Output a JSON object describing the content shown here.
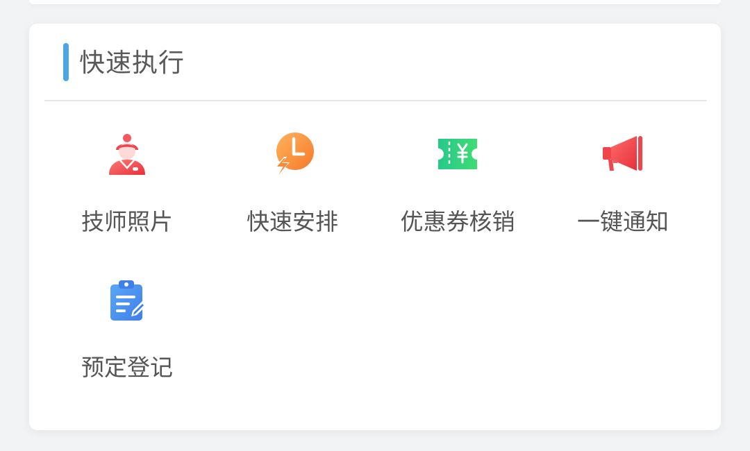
{
  "section": {
    "title": "快速执行",
    "accent_color": "#4ea5e6"
  },
  "actions": [
    {
      "label": "技师照片",
      "icon": "technician-icon",
      "color": "#f0454d"
    },
    {
      "label": "快速安排",
      "icon": "clock-lightning-icon",
      "color": "#f7903a"
    },
    {
      "label": "优惠券核销",
      "icon": "coupon-icon",
      "color": "#2fd27c"
    },
    {
      "label": "一键通知",
      "icon": "megaphone-icon",
      "color": "#f0454d"
    },
    {
      "label": "预定登记",
      "icon": "clipboard-icon",
      "color": "#4d8ff0"
    }
  ]
}
